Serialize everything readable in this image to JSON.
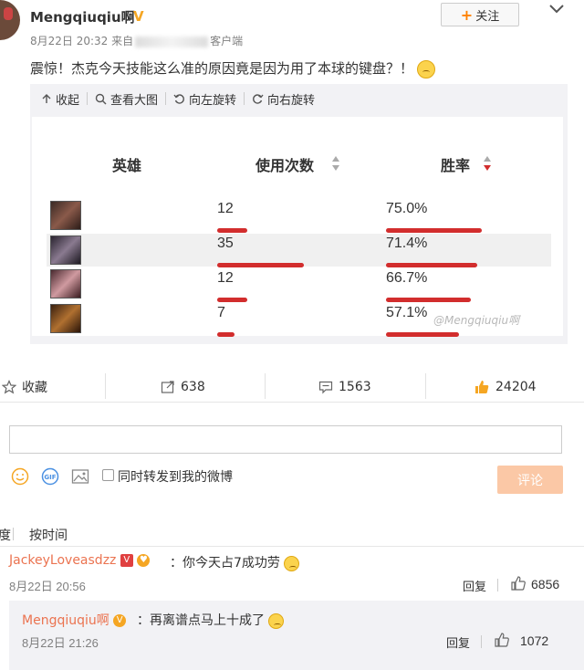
{
  "post": {
    "username": "Mengqiuqiu啊",
    "meta_date": "8月22日 20:32 来自",
    "meta_source": "客户端",
    "follow_label": "关注",
    "text": "震惊！杰克今天技能这么准的原因竟是因为用了本球的键盘？！"
  },
  "media_toolbar": {
    "collapse": "收起",
    "view_large": "查看大图",
    "rotate_left": "向左旋转",
    "rotate_right": "向右旋转"
  },
  "stats_table": {
    "headers": {
      "hero": "英雄",
      "uses": "使用次数",
      "winrate": "胜率"
    },
    "rows": [
      {
        "uses": 12,
        "uses_text": "12",
        "winrate": 75.0,
        "winrate_text": "75.0%"
      },
      {
        "uses": 35,
        "uses_text": "35",
        "winrate": 71.4,
        "winrate_text": "71.4%"
      },
      {
        "uses": 12,
        "uses_text": "12",
        "winrate": 66.7,
        "winrate_text": "66.7%"
      },
      {
        "uses": 7,
        "uses_text": "7",
        "winrate": 57.1,
        "winrate_text": "57.1%"
      }
    ],
    "watermark": "@Mengqiuqiu啊",
    "bar_color": "#d22d2d"
  },
  "actions": {
    "favorite": "收藏",
    "forward_count": "638",
    "comment_count": "1563",
    "like_count": "24204"
  },
  "comment_box": {
    "forward_checkbox_label": "同时转发到我的微博",
    "submit_label": "评论"
  },
  "sort": {
    "hot": "度",
    "by_time": "按时间"
  },
  "comments": [
    {
      "user": "JackeyLoveasdzz",
      "text": "：你今天占7成功劳",
      "time": "8月22日 20:56",
      "reply": "回复",
      "likes": "6856"
    }
  ],
  "sub_comments": [
    {
      "user": "Mengqiuqiu啊",
      "text": "：再离谱点马上十成了",
      "time": "8月22日 21:26",
      "reply": "回复",
      "likes": "1072"
    }
  ],
  "colors": {
    "accent_orange": "#ff8200",
    "username_link": "#eb7350",
    "submit_disabled": "#fbc8a6"
  }
}
